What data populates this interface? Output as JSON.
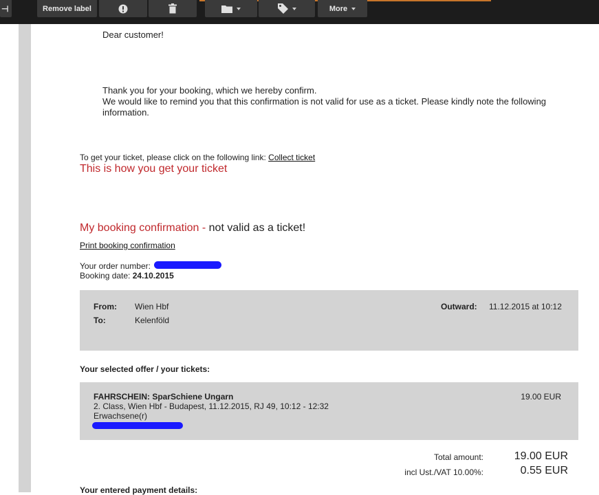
{
  "toolbar": {
    "left_glyph": "⊣",
    "remove_label": "Remove label",
    "report_icon": "report-spam-icon",
    "delete_icon": "trash-icon",
    "move_icon": "folder-icon",
    "labels_icon": "tag-icon",
    "more_label": "More"
  },
  "email": {
    "greeting": "Dear customer!",
    "thanks_line1": "Thank you for your booking, which we hereby confirm.",
    "thanks_line2": "We would like to remind you that this confirmation is not valid for use as a ticket. Please kindly note the following",
    "thanks_line3": "information.",
    "get_ticket_prefix": "To get your ticket, please click on the following link:",
    "collect_ticket_link": "Collect ticket",
    "how_to_heading": "This is how you get your ticket",
    "booking_heading_red": "My booking confirmation -",
    "booking_heading_black": "not valid as a ticket!",
    "print_link": "Print booking confirmation",
    "order_number_label": "Your order number:",
    "booking_date_label": "Booking date:",
    "booking_date_value": "24.10.2015"
  },
  "journey": {
    "from_label": "From:",
    "from_value": "Wien Hbf",
    "to_label": "To:",
    "to_value": "Kelenföld",
    "outward_label": "Outward:",
    "outward_value": "11.12.2015 at 10:12"
  },
  "offer": {
    "heading": "Your selected offer / your tickets:",
    "ticket_title": "FAHRSCHEIN: SparSchiene Ungarn",
    "ticket_details": "2. Class, Wien Hbf - Budapest, 11.12.2015, RJ 49, 10:12 - 12:32",
    "passenger_type": "Erwachsene(r)",
    "price": "19.00 EUR"
  },
  "totals": {
    "total_label": "Total amount:",
    "total_value": "19.00 EUR",
    "vat_label": "incl Ust./VAT 10.00%:",
    "vat_value": "0.55 EUR"
  },
  "payment": {
    "heading": "Your entered payment details:"
  },
  "colors": {
    "toolbar_bg": "#1c1c1c",
    "button_bg": "#3a3a3a",
    "accent_red": "#c0282c",
    "panel_grey": "#d3d3d3",
    "redaction_blue": "#1a1aff"
  }
}
